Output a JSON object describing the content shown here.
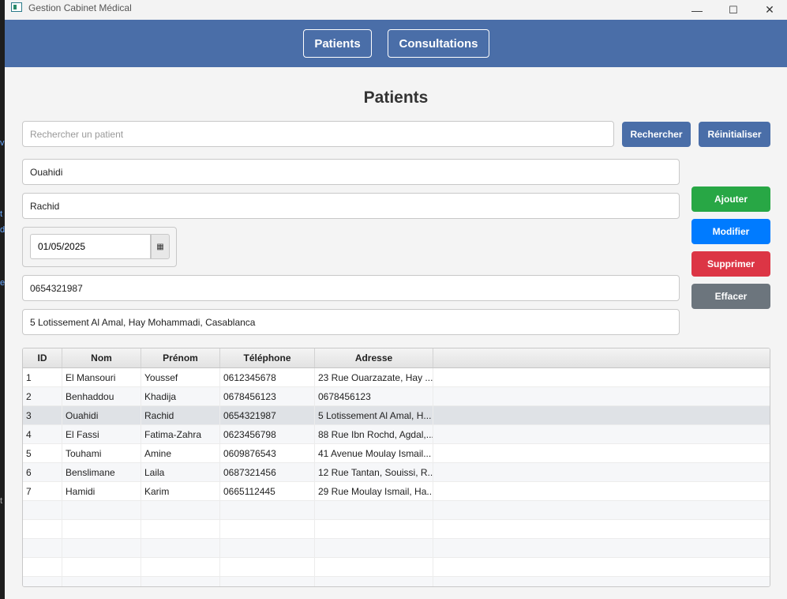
{
  "window": {
    "title": "Gestion Cabinet Médical",
    "controls": {
      "minimize": "—",
      "maximize": "☐",
      "close": "✕"
    }
  },
  "nav": {
    "patients": "Patients",
    "consultations": "Consultations"
  },
  "page": {
    "title": "Patients"
  },
  "search": {
    "placeholder": "Rechercher un patient",
    "search_label": "Rechercher",
    "reset_label": "Réinitialiser"
  },
  "form": {
    "nom": "Ouahidi",
    "prenom": "Rachid",
    "date": "01/05/2025",
    "telephone": "0654321987",
    "adresse": "5 Lotissement Al Amal, Hay Mohammadi, Casablanca"
  },
  "actions": {
    "add": "Ajouter",
    "edit": "Modifier",
    "delete": "Supprimer",
    "clear": "Effacer"
  },
  "colors": {
    "nav": "#4a6ea8",
    "add": "#28a745",
    "edit": "#007bff",
    "delete": "#dc3545",
    "clear": "#6c757d",
    "search": "#4a6ea8"
  },
  "table": {
    "columns": [
      "ID",
      "Nom",
      "Prénom",
      "Téléphone",
      "Adresse"
    ],
    "rows": [
      [
        "1",
        "El Mansouri",
        "Youssef",
        "0612345678",
        "23 Rue Ouarzazate, Hay ..."
      ],
      [
        "2",
        "Benhaddou",
        "Khadija",
        "0678456123",
        "0678456123"
      ],
      [
        "3",
        "Ouahidi",
        "Rachid",
        "0654321987",
        "5 Lotissement Al Amal, H..."
      ],
      [
        "4",
        "El Fassi",
        "Fatima-Zahra",
        "0623456798",
        "88 Rue Ibn Rochd, Agdal,..."
      ],
      [
        "5",
        "Touhami",
        "Amine",
        "0609876543",
        "41 Avenue Moulay Ismail..."
      ],
      [
        "6",
        "Benslimane",
        "Laila",
        "0687321456",
        "12 Rue Tantan, Souissi, R..."
      ],
      [
        "7",
        "Hamidi",
        "Karim",
        "0665112445",
        "29 Rue Moulay Ismail, Ha..."
      ]
    ],
    "selected_row": 3
  }
}
